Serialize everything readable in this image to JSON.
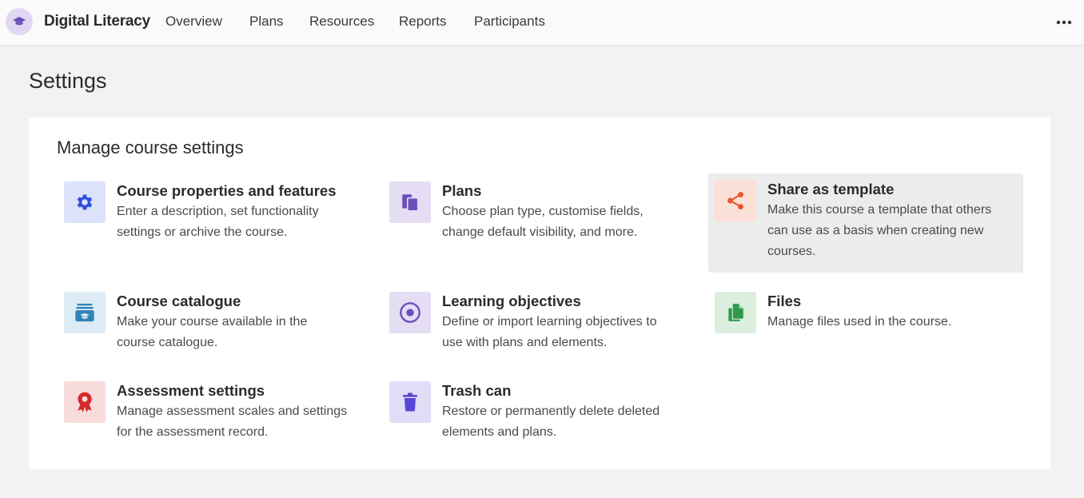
{
  "header": {
    "course_title": "Digital Literacy",
    "tabs": [
      {
        "label": "Overview"
      },
      {
        "label": "Plans"
      },
      {
        "label": "Resources"
      },
      {
        "label": "Reports"
      },
      {
        "label": "Participants"
      }
    ],
    "more_icon": "more-horizontal-icon"
  },
  "page": {
    "title": "Settings"
  },
  "card": {
    "title": "Manage course settings",
    "items": [
      {
        "title": "Course properties and features",
        "desc": [
          "Enter a description, set functionality",
          "settings or archive the course."
        ],
        "icon": "gear-icon",
        "icon_bg": "#dde3fb",
        "icon_color": "#2f4fe0"
      },
      {
        "title": "Plans",
        "desc": [
          "Choose plan type, customise fields,",
          "change default visibility, and more."
        ],
        "icon": "clipboard-icon",
        "icon_bg": "#e4ddf3",
        "icon_color": "#6b4fbb"
      },
      {
        "title": "Share as template",
        "desc": [
          "Make this course a template that others",
          "can use as a basis when creating new",
          "courses."
        ],
        "icon": "share-icon",
        "icon_bg": "#fbe0d8",
        "icon_color": "#e8572c"
      },
      {
        "title": "Course catalogue",
        "desc": [
          "Make your course available in the",
          "course catalogue."
        ],
        "icon": "catalogue-icon",
        "icon_bg": "#dcebf4",
        "icon_color": "#2d83b8"
      },
      {
        "title": "Learning objectives",
        "desc": [
          "Define or import learning objectives to",
          "use with plans and elements."
        ],
        "icon": "target-icon",
        "icon_bg": "#e4ddf3",
        "icon_color": "#6b4fbb"
      },
      {
        "title": "Files",
        "desc": [
          "Manage files used in the course."
        ],
        "icon": "files-icon",
        "icon_bg": "#dcefdf",
        "icon_color": "#2f9a4a"
      },
      {
        "title": "Assessment settings",
        "desc": [
          "Manage assessment scales and settings",
          "for the assessment record."
        ],
        "icon": "award-icon",
        "icon_bg": "#f8dcdc",
        "icon_color": "#d42b2b"
      },
      {
        "title": "Trash can",
        "desc": [
          "Restore or permanently delete deleted",
          "elements and plans."
        ],
        "icon": "trash-icon",
        "icon_bg": "#e0ddf7",
        "icon_color": "#5b47d6"
      }
    ]
  }
}
